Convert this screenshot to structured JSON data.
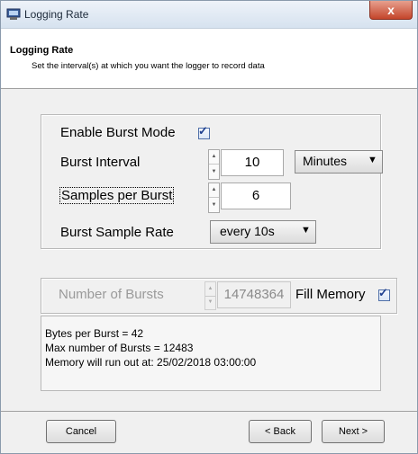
{
  "window": {
    "title": "Logging Rate",
    "close_label": "x"
  },
  "header": {
    "title": "Logging Rate",
    "subtitle": "Set the interval(s) at which you want the logger to record data"
  },
  "burst": {
    "enable_label": "Enable Burst Mode",
    "enable_checked": true,
    "interval_label": "Burst Interval",
    "interval_value": "10",
    "interval_unit": "Minutes",
    "samples_label": "Samples per Burst",
    "samples_value": "6",
    "rate_label": "Burst Sample Rate",
    "rate_value": "every 10s"
  },
  "bursts": {
    "count_label": "Number of Bursts",
    "count_value": "14748364",
    "fill_memory_label": "Fill Memory",
    "fill_memory_checked": true
  },
  "info": {
    "bytes_per_burst": "Bytes per Burst = 42",
    "max_bursts": "Max number of Bursts = 12483",
    "memory_out": "Memory will run out at: 25/02/2018 03:00:00"
  },
  "footer": {
    "cancel": "Cancel",
    "back": "< Back",
    "next": "Next >"
  },
  "icons": {
    "app": "logger-app-icon",
    "checkbox": "checkmark-icon",
    "spin_up": "spin-up-icon",
    "spin_down": "spin-down-icon",
    "dropdown": "dropdown-arrow-icon"
  }
}
